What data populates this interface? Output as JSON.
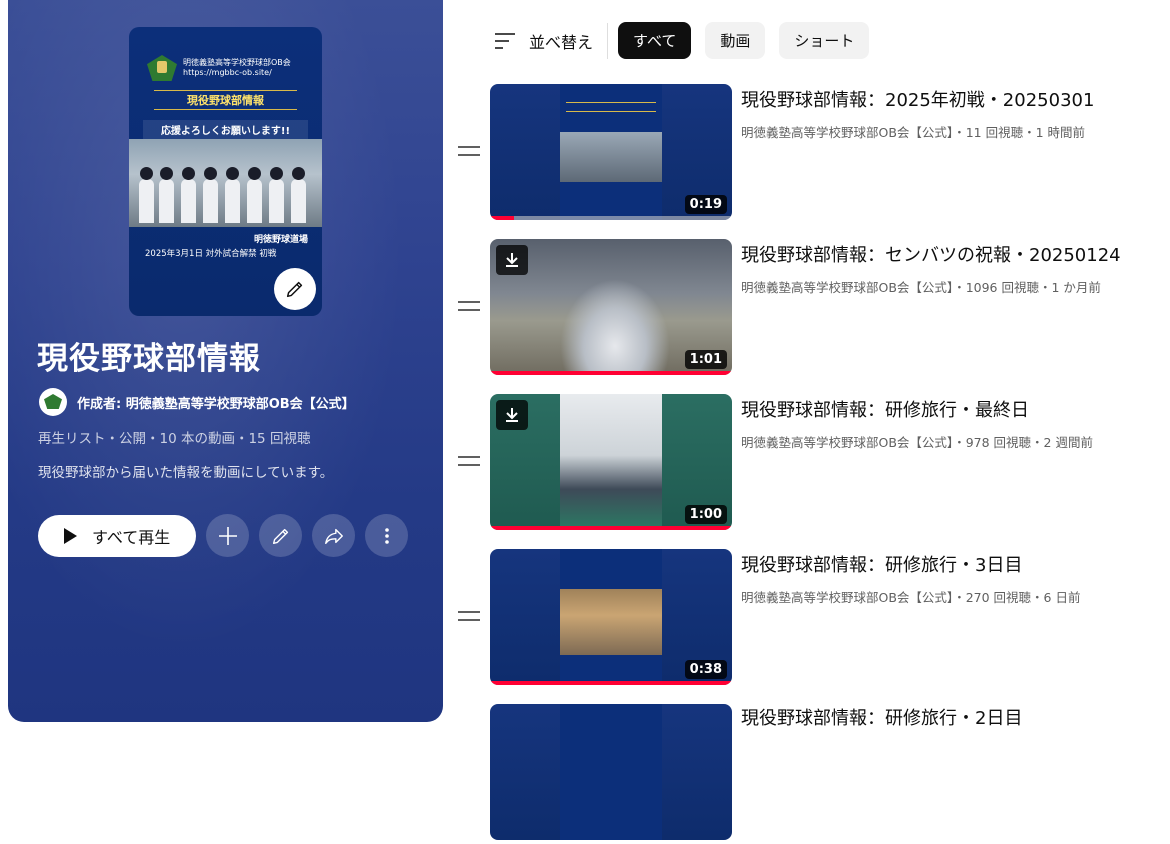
{
  "playlist": {
    "cover": {
      "org_line1": "明徳義塾高等学校野球部OB会",
      "org_line2": "https://mgbbc-ob.site/",
      "title": "現役野球部情報",
      "banner": "応援よろしくお願いします!!",
      "place": "明徳野球道場",
      "date": "2025年3月1日 対外試合解禁 初戦"
    },
    "title": "現役野球部情報",
    "author": "作成者: 明徳義塾高等学校野球部OB会【公式】",
    "meta": "再生リスト・公開・10 本の動画・15 回視聴",
    "description": "現役野球部から届いた情報を動画にしています。",
    "play_all_label": "すべて再生"
  },
  "sortbar": {
    "sort_label": "並べ替え",
    "chips": [
      "すべて",
      "動画",
      "ショート"
    ],
    "active_chip": "すべて"
  },
  "videos": [
    {
      "title": "現役野球部情報：2025年初戦・20250301",
      "channel": "明徳義塾高等学校野球部OB会【公式】",
      "stats": "11 回視聴・1 時間前",
      "duration": "0:19",
      "progress": 0.1
    },
    {
      "title": "現役野球部情報：センバツの祝報・20250124",
      "channel": "明徳義塾高等学校野球部OB会【公式】",
      "stats": "1096 回視聴・1 か月前",
      "duration": "1:01",
      "progress": 1.0
    },
    {
      "title": "現役野球部情報：研修旅行・最終日",
      "channel": "明徳義塾高等学校野球部OB会【公式】",
      "stats": "978 回視聴・2 週間前",
      "duration": "1:00",
      "progress": 1.0
    },
    {
      "title": "現役野球部情報：研修旅行・3日目",
      "channel": "明徳義塾高等学校野球部OB会【公式】",
      "stats": "270 回視聴・6 日前",
      "duration": "0:38",
      "progress": 1.0
    },
    {
      "title": "現役野球部情報：研修旅行・2日目"
    }
  ]
}
